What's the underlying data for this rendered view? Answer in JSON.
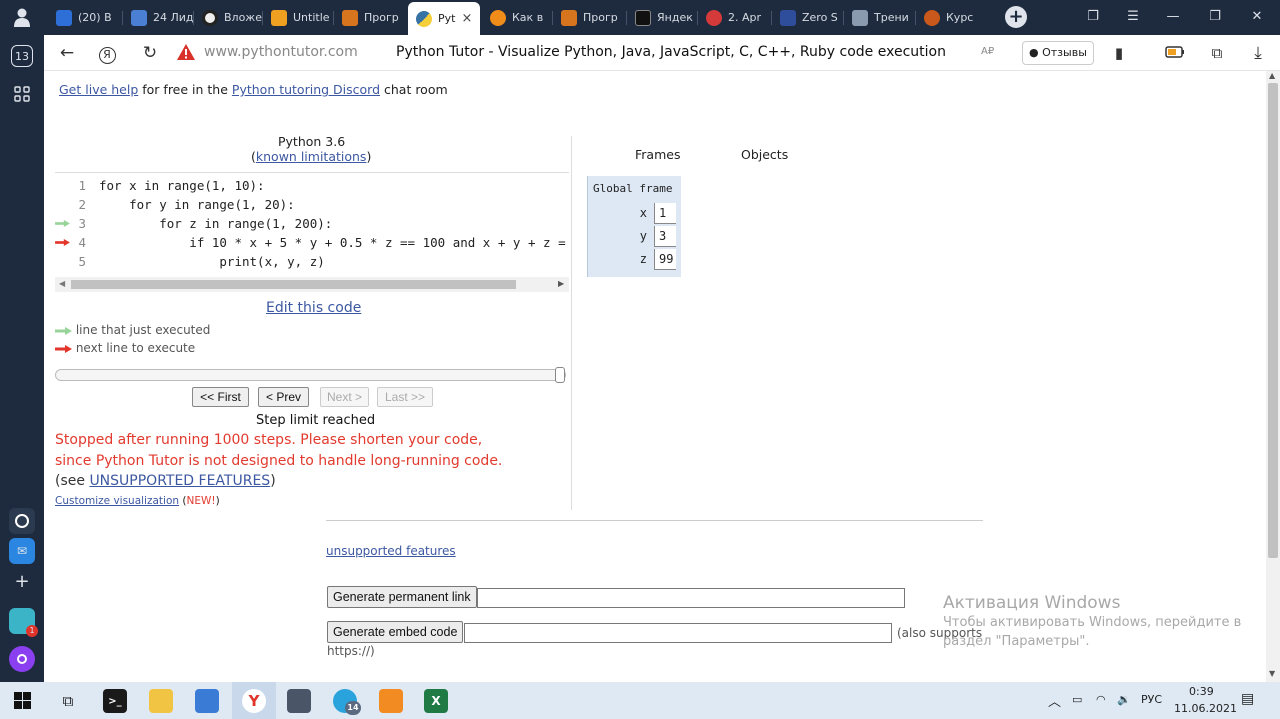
{
  "browser": {
    "tabs": [
      {
        "label": "(20) В",
        "color": "#2d6fd6"
      },
      {
        "label": "24 Лидь",
        "color": "#4a7fd4"
      },
      {
        "label": "Вложе",
        "color": "#222222"
      },
      {
        "label": "Untitle",
        "color": "#f0a020"
      },
      {
        "label": "Прогр",
        "color": "#d7741e"
      },
      {
        "label": "Pyt",
        "color": "#3772a4",
        "active": true
      },
      {
        "label": "Как в",
        "color": "#f08c1a"
      },
      {
        "label": "Прогр",
        "color": "#d7741e"
      },
      {
        "label": "Яндек",
        "color": "#111111"
      },
      {
        "label": "2. Apr",
        "color": "#d43a3a"
      },
      {
        "label": "Zero S",
        "color": "#2e4d9a"
      },
      {
        "label": "Трени",
        "color": "#8a9bb0"
      },
      {
        "label": "Курс",
        "color": "#c8581c"
      }
    ],
    "address": {
      "url": "www.pythontutor.com",
      "page_title": "Python Tutor - Visualize Python, Java, JavaScript, C, C++, Ruby code execution",
      "feedback_label": "Отзывы",
      "translate_label": "A₽"
    },
    "rail": {
      "badge_count": "13"
    }
  },
  "page": {
    "help": {
      "link1": "Get live help",
      "text1": " for free in the ",
      "link2": "Python tutoring Discord",
      "text2": " chat room"
    },
    "editor": {
      "language": "Python 3.6",
      "limitations_link": "known limitations",
      "code_lines": [
        {
          "num": "1",
          "text": "for x in range(1, 10):"
        },
        {
          "num": "2",
          "text": "    for y in range(1, 20):"
        },
        {
          "num": "3",
          "text": "        for z in range(1, 200):"
        },
        {
          "num": "4",
          "text": "            if 10 * x + 5 * y + 0.5 * z == 100 and x + y + z ="
        },
        {
          "num": "5",
          "text": "                print(x, y, z)"
        }
      ],
      "just_executed_line": 3,
      "next_line": 4,
      "edit_link": "Edit this code",
      "legend_executed": "line that just executed",
      "legend_next": "next line to execute",
      "slider_position": 1.0
    },
    "nav": {
      "first": "<< First",
      "prev": "< Prev",
      "next": "Next >",
      "last": "Last >>"
    },
    "status": {
      "step_limit": "Step limit reached",
      "error_line1": "Stopped after running 1000 steps. Please shorten your code,",
      "error_line2": "since Python Tutor is not designed to handle long-running code.",
      "see_prefix": "(see ",
      "see_link": "UNSUPPORTED FEATURES",
      "see_suffix": ")",
      "customize_link": "Customize visualization",
      "new_open": " (",
      "new_badge": "NEW!",
      "new_close": ")"
    },
    "viz": {
      "frames_header": "Frames",
      "objects_header": "Objects",
      "global_frame": "Global frame",
      "variables": [
        {
          "name": "x",
          "value": "1"
        },
        {
          "name": "y",
          "value": "3"
        },
        {
          "name": "z",
          "value": "99"
        }
      ]
    },
    "footer": {
      "unsupported_link": "unsupported features",
      "perm_button": "Generate permanent link",
      "embed_button": "Generate embed code",
      "embed_note_1": "(also supports",
      "embed_note_2": "https://)"
    },
    "watermark": {
      "title": "Активация Windows",
      "line1": "Чтобы активировать Windows, перейдите в",
      "line2": "раздел \"Параметры\"."
    }
  },
  "taskbar": {
    "time": "0:39",
    "date": "11.06.2021",
    "lang": "РУС",
    "telegram_badge": "14",
    "rail_badge": "1"
  },
  "colors": {
    "executed_arrow": "#98d49a",
    "next_arrow": "#e2352b",
    "frame_bg": "#dde8f4",
    "error_text": "#e23a2e",
    "link": "#3d58a2",
    "tab_bg": "#1e2b3e"
  }
}
